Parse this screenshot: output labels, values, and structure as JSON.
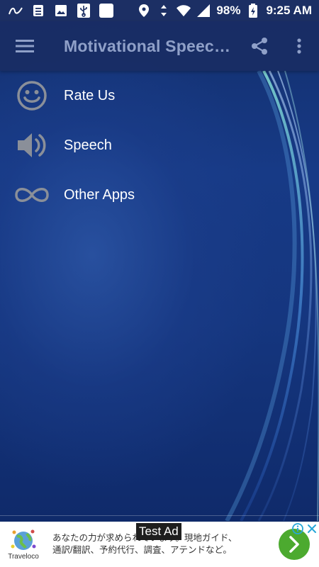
{
  "status_bar": {
    "battery": "98%",
    "time": "9:25 AM",
    "icons": [
      "notification-app-icon",
      "clipboard-icon",
      "image-icon",
      "usb-icon",
      "square-icon",
      "location-icon",
      "data-arrows-icon",
      "wifi-icon",
      "signal-icon",
      "battery-charging-icon"
    ]
  },
  "toolbar": {
    "title": "Motivational Speeches",
    "menu_icon": "hamburger-menu-icon",
    "share_icon": "share-icon",
    "overflow_icon": "more-vert-icon"
  },
  "menu": {
    "items": [
      {
        "label": "Rate Us",
        "icon": "smiley-face-icon"
      },
      {
        "label": "Speech",
        "icon": "speaker-icon"
      },
      {
        "label": "Other Apps",
        "icon": "infinity-icon"
      }
    ]
  },
  "ad": {
    "badge": "Test Ad",
    "logo_text": "Traveloco",
    "text_line1": "あなたの力が求められています。現地ガイド、",
    "text_line2": "通訳/翻訳、予約代行、調査、アテンドなど。",
    "go_icon": "chevron-right-icon",
    "info_icon": "info-icon",
    "close_icon": "close-icon"
  },
  "colors": {
    "toolbar_title": "#8fa0c8",
    "icon_gray": "#8a8f99",
    "background": "#13306f",
    "ad_button": "#4caa2f"
  }
}
